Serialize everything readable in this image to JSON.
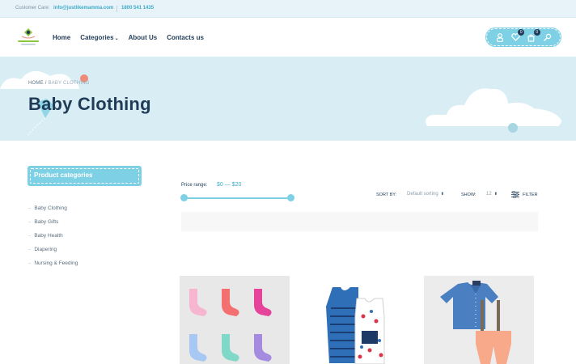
{
  "topbar": {
    "customer_care_label": "Customer Care:",
    "email": "info@justlikemamma.com",
    "phone": "1800 541 1435"
  },
  "nav": {
    "items": [
      {
        "label": "Home"
      },
      {
        "label": "Categories"
      },
      {
        "label": "About Us"
      },
      {
        "label": "Contacts us"
      }
    ]
  },
  "header_icons": {
    "wishlist_count": "0",
    "cart_count": "0"
  },
  "hero": {
    "breadcrumb_home": "HOME",
    "breadcrumb_separator": "/",
    "breadcrumb_current": "BABY CLOTHING",
    "title": "Baby Clothing"
  },
  "sidebar": {
    "title": "Product categories",
    "categories": [
      "Baby Clothing",
      "Baby Gifts",
      "Baby Health",
      "Diapering",
      "Nursing & Feeding"
    ]
  },
  "filters": {
    "price_label": "Price range:",
    "price_value": "$0 — $20",
    "sort_label": "SORT BY:",
    "sort_value": "Default sorting",
    "show_label": "SHOW:",
    "show_value": "12",
    "filter_label": "FILTER"
  },
  "products": [
    {
      "image": "colorful-socks"
    },
    {
      "image": "striped-rompers"
    },
    {
      "image": "denim-shirt-overalls"
    }
  ],
  "colors": {
    "accent": "#7ed0e4",
    "navy": "#1f3b57",
    "hero_bg": "#d9edf4",
    "link": "#3eaac9"
  }
}
